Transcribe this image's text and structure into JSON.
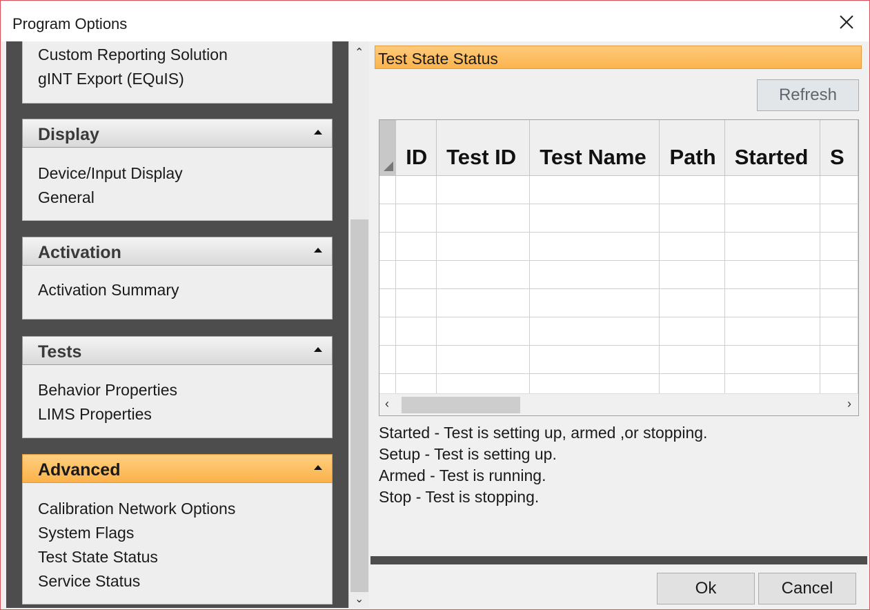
{
  "window": {
    "title": "Program Options"
  },
  "nav": {
    "top_group": {
      "items": [
        "Custom Reporting Solution",
        "gINT Export (EQuIS)"
      ]
    },
    "groups": [
      {
        "title": "Display",
        "active": false,
        "items": [
          "Device/Input Display",
          "General"
        ]
      },
      {
        "title": "Activation",
        "active": false,
        "items": [
          "Activation Summary"
        ]
      },
      {
        "title": "Tests",
        "active": false,
        "items": [
          "Behavior Properties",
          "LIMS Properties"
        ]
      },
      {
        "title": "Advanced",
        "active": true,
        "items": [
          "Calibration Network Options",
          "System Flags",
          "Test State Status",
          "Service Status"
        ]
      }
    ]
  },
  "main": {
    "section_title": "Test State Status",
    "refresh_label": "Refresh",
    "grid": {
      "columns": [
        "ID",
        "Test ID",
        "Test Name",
        "Path",
        "Started",
        "S"
      ],
      "empty_rows": 8
    },
    "legend": [
      "Started - Test is setting up, armed ,or stopping.",
      "Setup - Test is setting up.",
      "Armed - Test is running.",
      "Stop - Test is stopping."
    ]
  },
  "footer": {
    "ok_label": "Ok",
    "cancel_label": "Cancel"
  },
  "colors": {
    "accent": "#fbb44e",
    "nav_background": "#4d4d4d",
    "window_border": "#d9505a"
  }
}
